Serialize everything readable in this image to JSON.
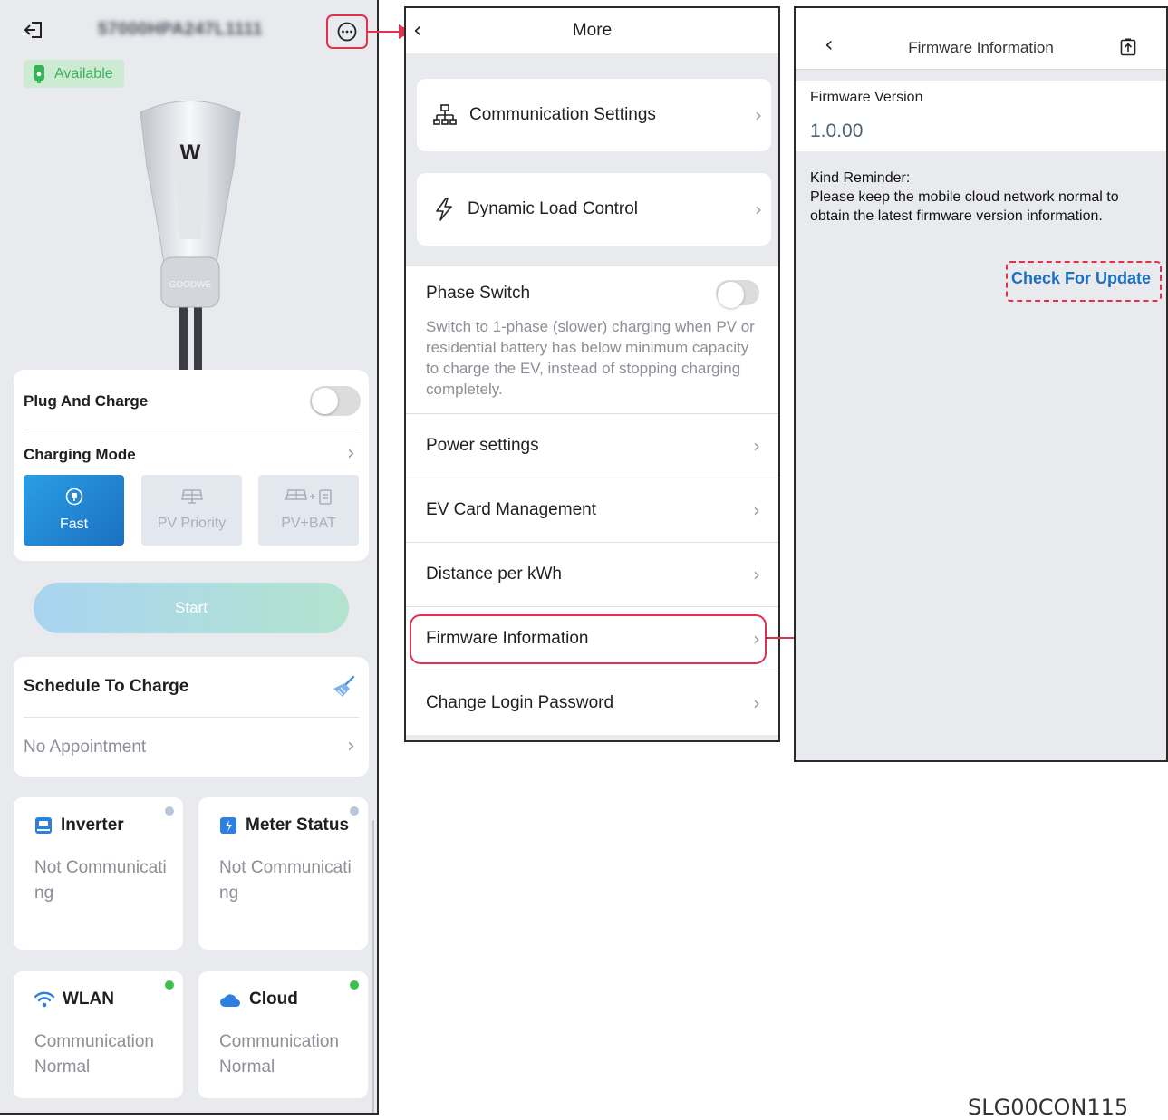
{
  "colors": {
    "highlight_red": "#e0314d",
    "accent_blue": "#1b6fc1",
    "status_green": "#38b25a"
  },
  "home": {
    "device_id": "57000HPA247L1111",
    "status_badge": "Available",
    "plug_and_charge_label": "Plug And Charge",
    "plug_and_charge_on": false,
    "charging_mode_label": "Charging Mode",
    "modes": [
      {
        "label": "Fast",
        "icon": "plug-icon",
        "selected": true
      },
      {
        "label": "PV Priority",
        "icon": "solar-panel-icon",
        "selected": false
      },
      {
        "label": "PV+BAT",
        "icon": "solar-battery-icon",
        "selected": false
      }
    ],
    "start_label": "Start",
    "schedule_title": "Schedule To Charge",
    "schedule_value": "No Appointment",
    "status_cards": [
      {
        "title": "Inverter",
        "value": "Not Communicating",
        "icon": "inverter-icon",
        "dot": "grey"
      },
      {
        "title": "Meter Status",
        "value": "Not Communicating",
        "icon": "meter-icon",
        "dot": "grey"
      },
      {
        "title": "WLAN",
        "value": "Communication Normal",
        "icon": "wifi-icon",
        "dot": "green"
      },
      {
        "title": "Cloud",
        "value": "Communication Normal",
        "icon": "cloud-icon",
        "dot": "green"
      }
    ]
  },
  "more": {
    "title": "More",
    "communication_settings": "Communication Settings",
    "dynamic_load_control": "Dynamic Load Control",
    "phase_switch_title": "Phase Switch",
    "phase_switch_on": false,
    "phase_switch_desc": "Switch to 1-phase (slower) charging when PV or residential battery has below minimum capacity to charge the EV, instead of stopping charging completely.",
    "items": [
      "Power settings",
      "EV Card Management",
      "Distance per kWh",
      "Firmware Information",
      "Change Login Password"
    ]
  },
  "firmware": {
    "title": "Firmware Information",
    "version_label": "Firmware Version",
    "version_value": "1.0.00",
    "reminder": "Kind Reminder:\nPlease keep the mobile cloud network normal to obtain the latest firmware version information.",
    "check_update": "Check For Update"
  },
  "figure_code": "SLG00CON115"
}
